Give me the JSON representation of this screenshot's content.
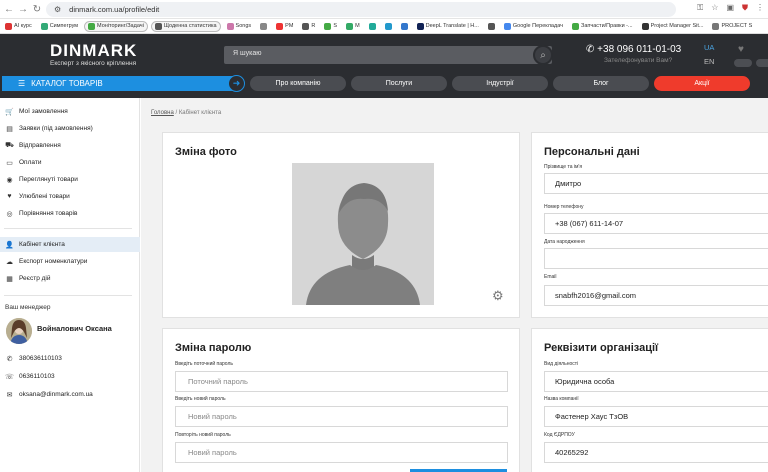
{
  "browser": {
    "url": "dinmark.com.ua/profile/edit",
    "bookmarks": [
      {
        "label": "AI курс",
        "color": "#d33"
      },
      {
        "label": "Симпегрум",
        "color": "#3a7"
      },
      {
        "label": "Моніторинг/Задачі",
        "color": "#4a4",
        "chip": true
      },
      {
        "label": "Щоденна статистика",
        "color": "#555",
        "chip": true
      },
      {
        "label": "Songs",
        "color": "#c7a"
      },
      {
        "label": "",
        "color": "#888"
      },
      {
        "label": "PM",
        "color": "#e33"
      },
      {
        "label": "R",
        "color": "#555"
      },
      {
        "label": "S",
        "color": "#4a4"
      },
      {
        "label": "M",
        "color": "#3a6"
      },
      {
        "label": "",
        "color": "#2a9"
      },
      {
        "label": "",
        "color": "#29c"
      },
      {
        "label": "",
        "color": "#37c"
      },
      {
        "label": "DeepL Translate | H...",
        "color": "#125"
      },
      {
        "label": "",
        "color": "#555"
      },
      {
        "label": "Google Перекладач",
        "color": "#48e"
      },
      {
        "label": "Запчасти/Правки -...",
        "color": "#4a4"
      },
      {
        "label": "Project Manager Sit...",
        "color": "#333"
      },
      {
        "label": "PROJECT S",
        "color": "#777"
      }
    ]
  },
  "header": {
    "logo": "DINMARK",
    "tagline": "Експерт з якісного кріплення",
    "search_placeholder": "Я шукаю",
    "phone": "+38 096 011-01-03",
    "callback": "Зателефонувати Вам?",
    "lang_active": "UA",
    "lang_other": "EN",
    "catalog": "КАТАЛОГ ТОВАРІВ",
    "menu": [
      "Про компанію",
      "Послуги",
      "Індустрії",
      "Блог",
      "Акції"
    ]
  },
  "sidebar": {
    "group1": [
      "Мої замовлення",
      "Заявки (під замовлення)",
      "Відправлення",
      "Оплати",
      "Переглянуті товари",
      "Улюблені товари",
      "Порівняння товарів"
    ],
    "group2": [
      "Кабінет клієнта",
      "Експорт номенклатури",
      "Реєстр дій"
    ],
    "manager_label": "Ваш менеджер",
    "manager_name": "Войналович Оксана",
    "contacts": [
      "380636110103",
      "0636110103",
      "oksana@dinmark.com.ua"
    ]
  },
  "content": {
    "breadcrumb_home": "Головна",
    "breadcrumb_sep": " / ",
    "breadcrumb_current": "Кабінет клієнта",
    "photo_title": "Зміна фото",
    "personal": {
      "title": "Персональні дані",
      "name_label": "Прізвище та ім'я",
      "name_value": "Дмитро",
      "phone_label": "Номер телефону",
      "phone_value": "+38 (067) 611-14-07",
      "dob_label": "Дата народження",
      "dob_value": "",
      "email_label": "Email",
      "email_value": "snabfh2016@gmail.com"
    },
    "password": {
      "title": "Зміна паролю",
      "current_label": "Введіть поточний пароль",
      "current_placeholder": "Поточний пароль",
      "new_label": "Введіть новий пароль",
      "new_placeholder": "Новий пароль",
      "repeat_label": "Повторіть новий пароль",
      "repeat_placeholder": "Новий пароль"
    },
    "org": {
      "title": "Реквізити організації",
      "activity_label": "Вид діяльності",
      "activity_value": "Юридична особа",
      "company_label": "Назва компанії",
      "company_value": "Фастенер Хаус ТзОВ",
      "edrpou_label": "Код ЄДРПОУ",
      "edrpou_value": "40265292"
    }
  },
  "colors": {
    "accent": "#1d8fe0",
    "header_bg": "#2b2d31",
    "sale": "#ef3b2c"
  }
}
